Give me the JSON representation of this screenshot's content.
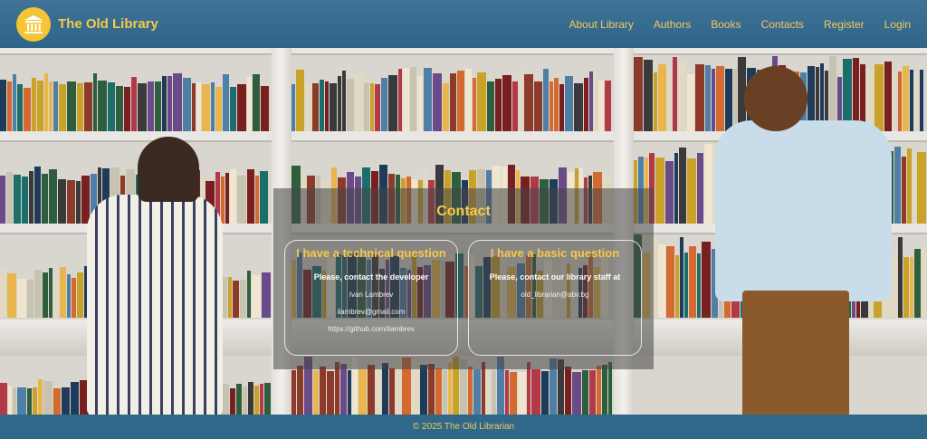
{
  "header": {
    "brand": "The Old Library",
    "logo_icon": "library-building-icon",
    "nav": [
      "About Library",
      "Authors",
      "Books",
      "Contacts",
      "Register",
      "Login"
    ]
  },
  "contact": {
    "title": "Contact",
    "technical": {
      "heading": "I have a technical question",
      "lead": "Please, contact the developer",
      "name": "Ivan Lambrev",
      "email": "ilambrev@gmail.com",
      "github": "https://github.com/ilambrev"
    },
    "basic": {
      "heading": "I have a basic question",
      "lead": "Please, contact our library staff at",
      "email": "old_librarian@abv.bg"
    }
  },
  "footer": {
    "text": "© 2025 The Old Librarian"
  },
  "colors": {
    "accent": "#f6c94a",
    "header": "#2f6489",
    "footer": "#2f6889"
  }
}
